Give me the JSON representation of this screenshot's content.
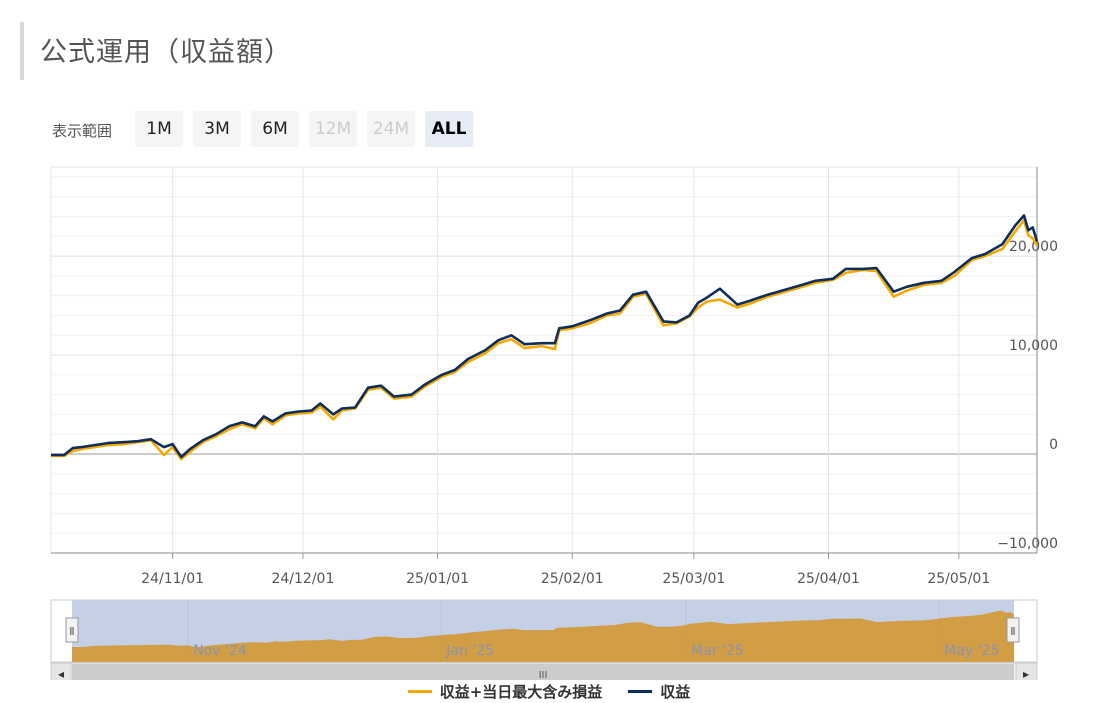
{
  "page": {
    "title": "公式運用（収益額）"
  },
  "range_selector": {
    "label": "表示範囲",
    "buttons": [
      {
        "label": "1M",
        "state": "enabled"
      },
      {
        "label": "3M",
        "state": "enabled"
      },
      {
        "label": "6M",
        "state": "enabled"
      },
      {
        "label": "12M",
        "state": "disabled"
      },
      {
        "label": "24M",
        "state": "disabled"
      },
      {
        "label": "ALL",
        "state": "selected"
      }
    ]
  },
  "colors": {
    "series_total": "#f5a800",
    "series_profit": "#0d2e5c",
    "navigator_fill": "#d29a3c",
    "navigator_selection": "#c5d0e6"
  },
  "chart_data": {
    "type": "line",
    "y_axis": {
      "ylim": [
        -10000,
        29000
      ],
      "ticks": [
        -10000,
        0,
        10000,
        20000
      ],
      "tick_labels": [
        "−10,000",
        "0",
        "10,000",
        "20,000"
      ],
      "side": "right"
    },
    "x_axis": {
      "xlim": [
        "2024-10-04",
        "2025-05-19"
      ],
      "ticks": [
        "2024-11-01",
        "2024-12-01",
        "2025-01-01",
        "2025-02-01",
        "2025-03-01",
        "2025-04-01",
        "2025-05-01"
      ],
      "tick_labels": [
        "24/11/01",
        "24/12/01",
        "25/01/01",
        "25/02/01",
        "25/03/01",
        "25/04/01",
        "25/05/01"
      ]
    },
    "grid": true,
    "legend_position": "bottom-center",
    "series": [
      {
        "name": "収益+当日最大含み損益",
        "color_key": "series_total",
        "x": [
          "2024-10-04",
          "2024-10-07",
          "2024-10-09",
          "2024-10-11",
          "2024-10-14",
          "2024-10-17",
          "2024-10-21",
          "2024-10-24",
          "2024-10-27",
          "2024-10-30",
          "2024-11-01",
          "2024-11-03",
          "2024-11-05",
          "2024-11-08",
          "2024-11-11",
          "2024-11-14",
          "2024-11-17",
          "2024-11-20",
          "2024-11-22",
          "2024-11-24",
          "2024-11-27",
          "2024-11-30",
          "2024-12-03",
          "2024-12-05",
          "2024-12-08",
          "2024-12-10",
          "2024-12-13",
          "2024-12-16",
          "2024-12-19",
          "2024-12-22",
          "2024-12-26",
          "2024-12-29",
          "2025-01-02",
          "2025-01-05",
          "2025-01-08",
          "2025-01-12",
          "2025-01-15",
          "2025-01-18",
          "2025-01-21",
          "2025-01-25",
          "2025-01-28",
          "2025-01-29",
          "2025-02-01",
          "2025-02-05",
          "2025-02-09",
          "2025-02-12",
          "2025-02-15",
          "2025-02-18",
          "2025-02-22",
          "2025-02-25",
          "2025-02-28",
          "2025-03-02",
          "2025-03-04",
          "2025-03-07",
          "2025-03-11",
          "2025-03-14",
          "2025-03-18",
          "2025-03-22",
          "2025-03-26",
          "2025-03-29",
          "2025-04-02",
          "2025-04-05",
          "2025-04-09",
          "2025-04-12",
          "2025-04-16",
          "2025-04-19",
          "2025-04-23",
          "2025-04-27",
          "2025-04-30",
          "2025-05-04",
          "2025-05-07",
          "2025-05-11",
          "2025-05-14",
          "2025-05-16",
          "2025-05-17",
          "2025-05-18",
          "2025-05-19"
        ],
        "values": [
          -200,
          -200,
          300,
          500,
          700,
          900,
          1000,
          1200,
          1400,
          -100,
          700,
          -500,
          200,
          1200,
          1800,
          2500,
          3000,
          2600,
          3600,
          3000,
          3900,
          4100,
          4200,
          4800,
          3500,
          4400,
          4600,
          6500,
          6700,
          5600,
          5800,
          6800,
          7800,
          8300,
          9300,
          10200,
          11200,
          11600,
          10700,
          10900,
          10600,
          12500,
          12700,
          13200,
          14000,
          14200,
          15900,
          16200,
          13000,
          13200,
          13900,
          14800,
          15400,
          15600,
          14800,
          15200,
          15900,
          16400,
          16900,
          17300,
          17600,
          18300,
          18600,
          18500,
          15900,
          16500,
          17100,
          17300,
          18000,
          19600,
          20000,
          20700,
          22500,
          23600,
          22100,
          21800,
          21100
        ]
      },
      {
        "name": "収益",
        "color_key": "series_profit",
        "x": [
          "2024-10-04",
          "2024-10-07",
          "2024-10-09",
          "2024-10-11",
          "2024-10-14",
          "2024-10-17",
          "2024-10-21",
          "2024-10-24",
          "2024-10-27",
          "2024-10-30",
          "2024-11-01",
          "2024-11-03",
          "2024-11-05",
          "2024-11-08",
          "2024-11-11",
          "2024-11-14",
          "2024-11-17",
          "2024-11-20",
          "2024-11-22",
          "2024-11-24",
          "2024-11-27",
          "2024-11-30",
          "2024-12-03",
          "2024-12-05",
          "2024-12-08",
          "2024-12-10",
          "2024-12-13",
          "2024-12-16",
          "2024-12-19",
          "2024-12-22",
          "2024-12-26",
          "2024-12-29",
          "2025-01-02",
          "2025-01-05",
          "2025-01-08",
          "2025-01-12",
          "2025-01-15",
          "2025-01-18",
          "2025-01-21",
          "2025-01-25",
          "2025-01-28",
          "2025-01-29",
          "2025-02-01",
          "2025-02-05",
          "2025-02-09",
          "2025-02-12",
          "2025-02-15",
          "2025-02-18",
          "2025-02-22",
          "2025-02-25",
          "2025-02-28",
          "2025-03-02",
          "2025-03-04",
          "2025-03-07",
          "2025-03-11",
          "2025-03-14",
          "2025-03-18",
          "2025-03-22",
          "2025-03-26",
          "2025-03-29",
          "2025-04-02",
          "2025-04-05",
          "2025-04-09",
          "2025-04-12",
          "2025-04-16",
          "2025-04-19",
          "2025-04-23",
          "2025-04-27",
          "2025-04-30",
          "2025-05-04",
          "2025-05-07",
          "2025-05-11",
          "2025-05-14",
          "2025-05-16",
          "2025-05-17",
          "2025-05-18",
          "2025-05-19"
        ],
        "values": [
          -100,
          -100,
          600,
          700,
          900,
          1100,
          1200,
          1300,
          1500,
          700,
          1000,
          -300,
          500,
          1400,
          2000,
          2800,
          3200,
          2800,
          3800,
          3300,
          4100,
          4300,
          4400,
          5100,
          4000,
          4600,
          4700,
          6700,
          6900,
          5800,
          6000,
          7000,
          8000,
          8500,
          9600,
          10500,
          11500,
          12000,
          11100,
          11200,
          11200,
          12700,
          12900,
          13500,
          14200,
          14500,
          16100,
          16400,
          13400,
          13300,
          14000,
          15300,
          15800,
          16700,
          15100,
          15500,
          16100,
          16600,
          17100,
          17500,
          17700,
          18700,
          18700,
          18800,
          16400,
          16900,
          17300,
          17500,
          18400,
          19800,
          20200,
          21200,
          23100,
          24100,
          22600,
          22900,
          21500
        ]
      }
    ]
  },
  "navigator": {
    "tick_labels": [
      "Nov '24",
      "Jan '25",
      "Mar '25",
      "May '25"
    ],
    "tick_dates": [
      "2024-11-01",
      "2025-01-01",
      "2025-03-01",
      "2025-05-01"
    ],
    "scroll_left_icon": "◂",
    "scroll_right_icon": "▸",
    "handle_icon": "Ⅱ",
    "scroll_thumb_icon": "III"
  }
}
